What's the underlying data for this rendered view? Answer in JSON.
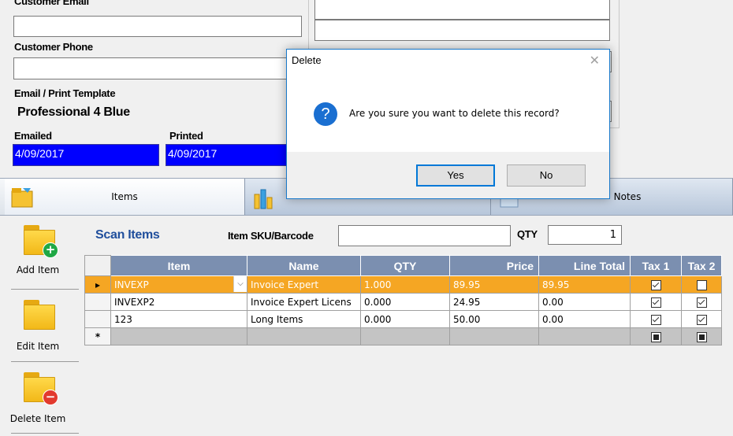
{
  "form": {
    "customer_email_label": "Customer Email",
    "customer_phone_label": "Customer Phone",
    "template_label": "Email / Print Template",
    "template_value": "Professional 4 Blue",
    "emailed_label": "Emailed",
    "emailed_value": "4/09/2017",
    "printed_label": "Printed",
    "printed_value": "4/09/2017"
  },
  "tabs": [
    {
      "label": "Items",
      "icon": "items-tab-icon"
    },
    {
      "label": "",
      "icon": "payments-tab-icon"
    },
    {
      "label": "Notes",
      "icon": "notes-tab-icon"
    }
  ],
  "toolbar": {
    "add_label": "Add Item",
    "edit_label": "Edit Item",
    "delete_label": "Delete Item"
  },
  "scan": {
    "title": "Scan Items",
    "sku_label": "Item SKU/Barcode",
    "sku_value": "",
    "qty_label": "QTY",
    "qty_value": "1"
  },
  "grid": {
    "columns": [
      "Item",
      "Name",
      "QTY",
      "Price",
      "Line Total",
      "Tax 1",
      "Tax 2"
    ],
    "rows": [
      {
        "item": "INVEXP",
        "name": "Invoice Expert",
        "qty": "1.000",
        "price": "89.95",
        "total": "89.95",
        "tax1": true,
        "tax2": false
      },
      {
        "item": "INVEXP2",
        "name": "Invoice Expert Licens",
        "qty": "0.000",
        "price": "24.95",
        "total": "0.00",
        "tax1": true,
        "tax2": true
      },
      {
        "item": "123",
        "name": "Long Items",
        "qty": "0.000",
        "price": "50.00",
        "total": "0.00",
        "tax1": true,
        "tax2": true
      }
    ],
    "new_row_marker": "*",
    "current_row_marker": "▸"
  },
  "dialog": {
    "title": "Delete",
    "message": "Are you sure you want to delete this record?",
    "yes_label": "Yes",
    "no_label": "No",
    "close_glyph": "✕",
    "icon_glyph": "?"
  },
  "colors": {
    "selected_row": "#f5a623",
    "header": "#7b8fb0",
    "blue_field": "#0000ff",
    "scan_title": "#1f4e9c"
  }
}
